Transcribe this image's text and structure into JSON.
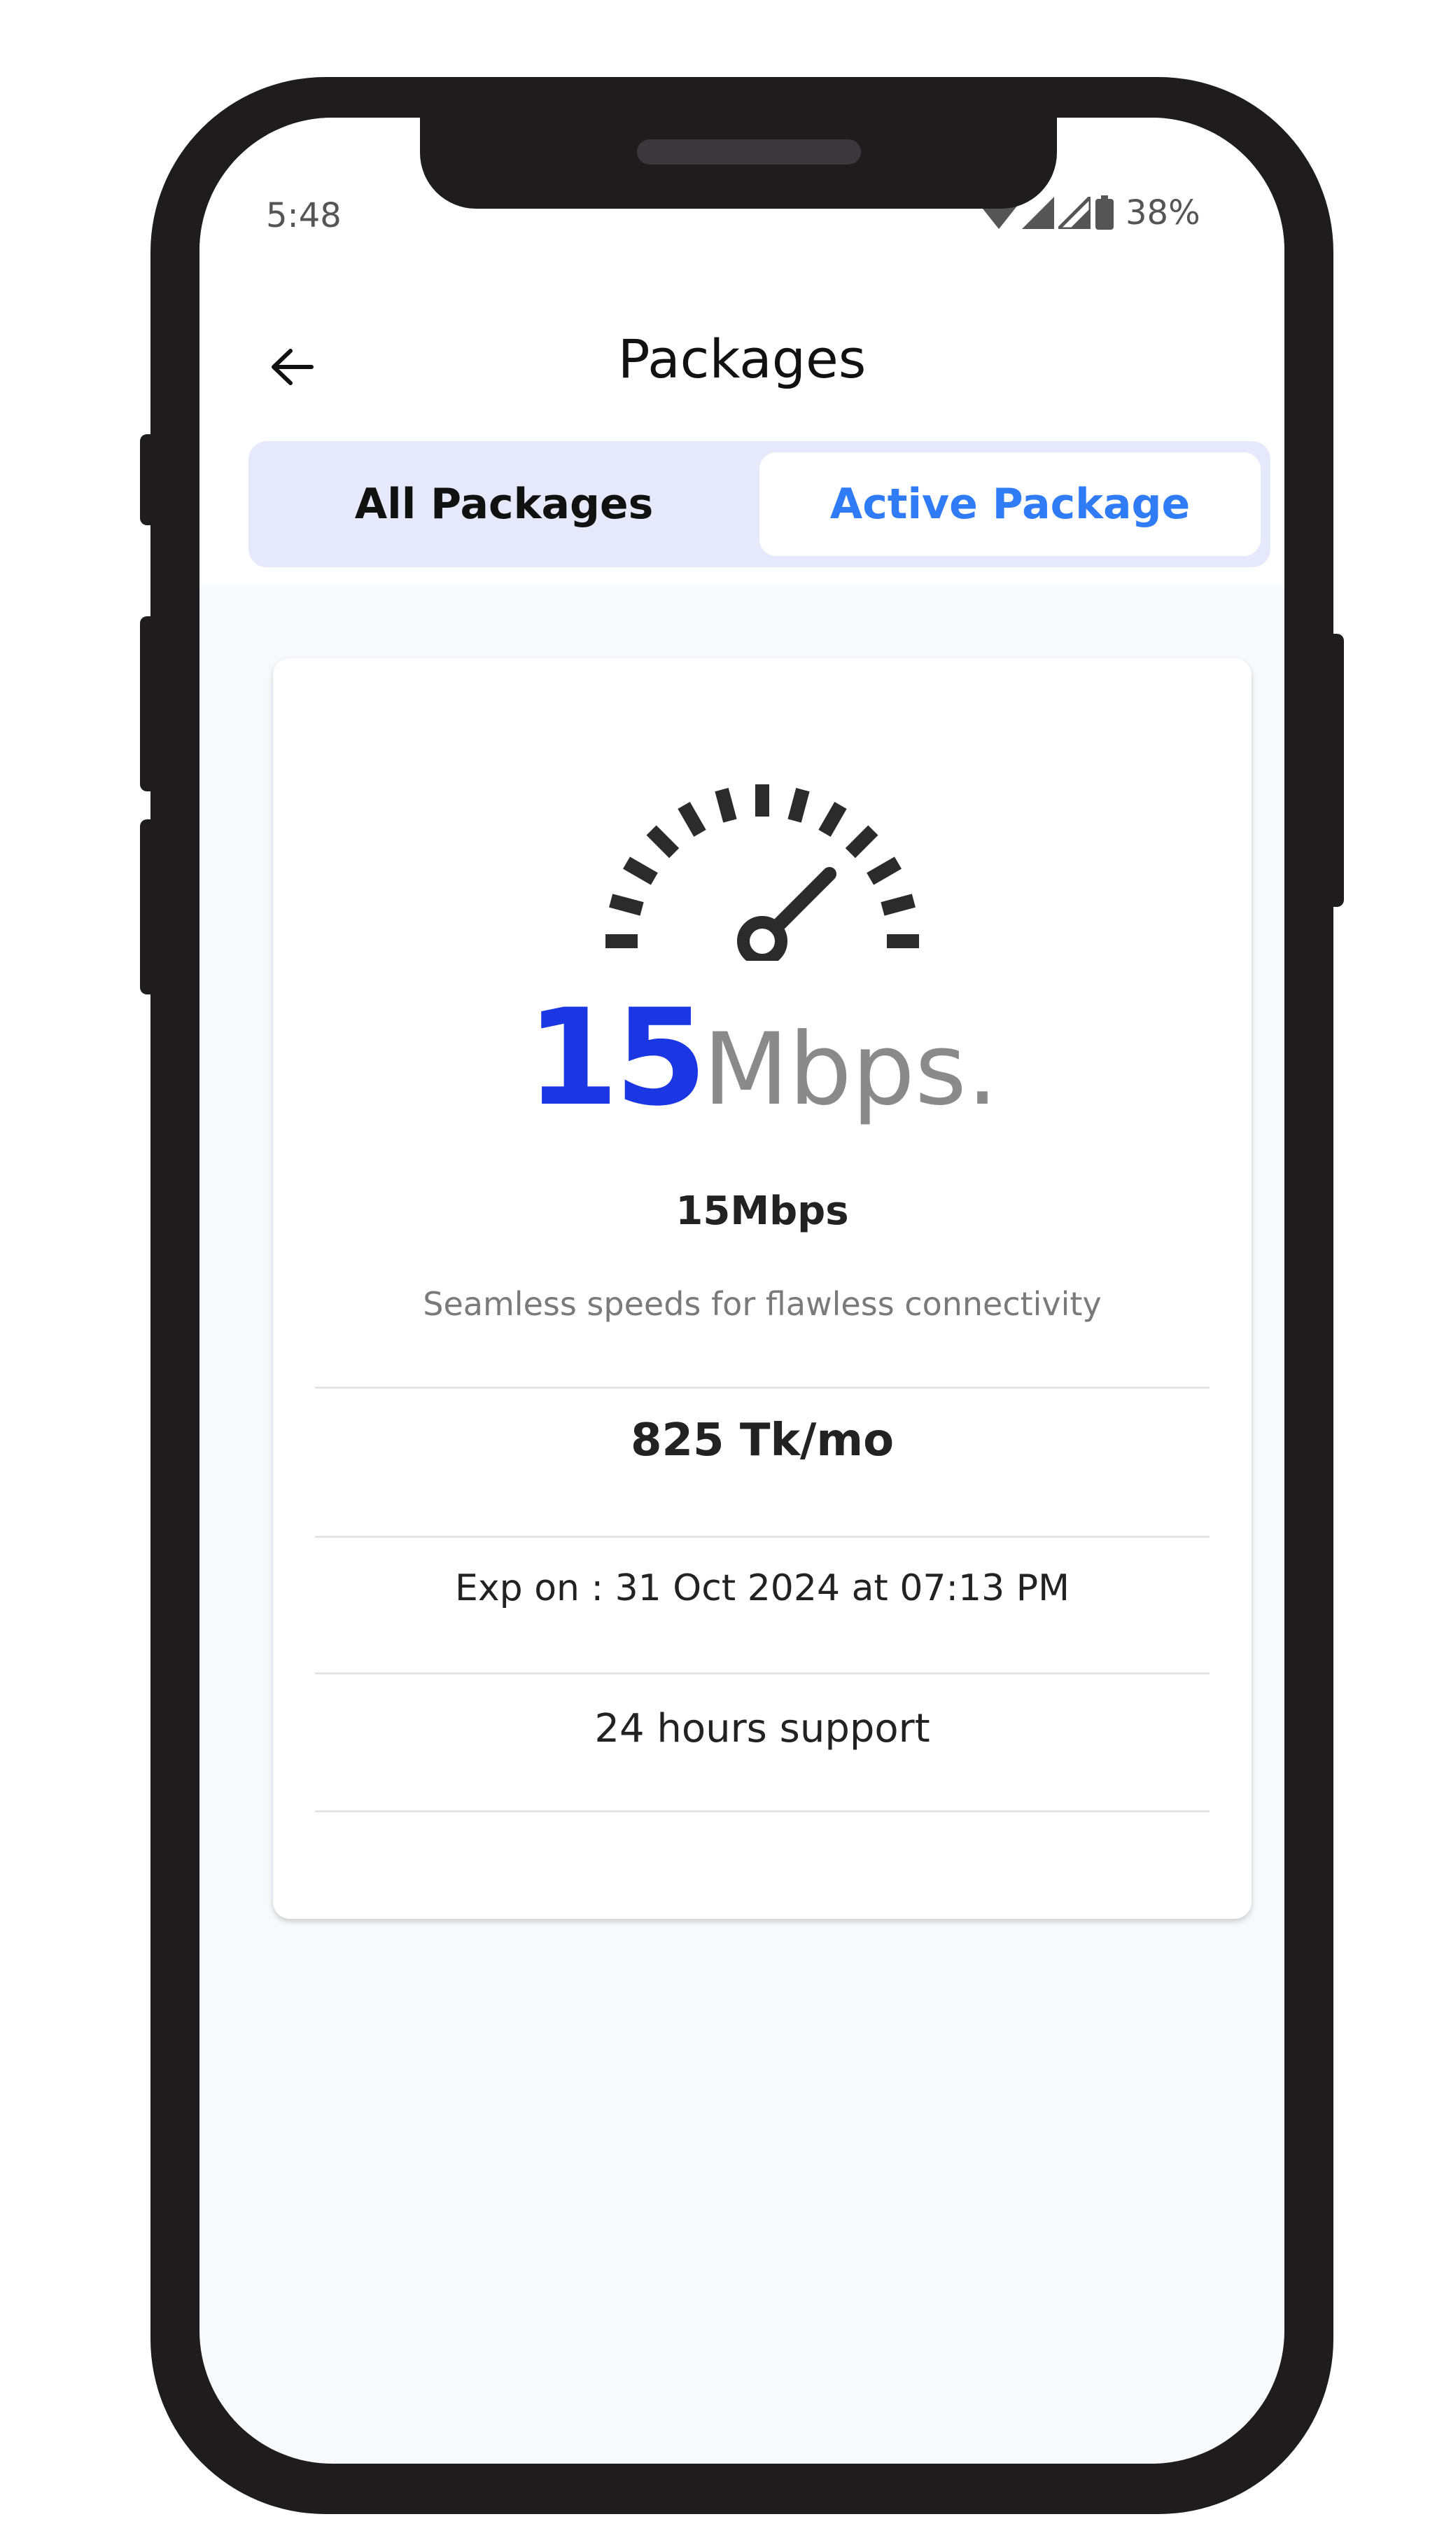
{
  "status_bar": {
    "time": "5:48",
    "battery": "38%",
    "icons": [
      "wifi-icon",
      "signal-icon",
      "signal-icon",
      "battery-icon"
    ]
  },
  "header": {
    "title": "Packages",
    "back_icon": "back-arrow-icon"
  },
  "tabs": [
    {
      "label": "All Packages",
      "selected": false
    },
    {
      "label": "Active Package",
      "selected": true
    }
  ],
  "package": {
    "speed_value": "15",
    "speed_unit": "Mbps.",
    "name": "15Mbps",
    "description": "Seamless speeds for flawless connectivity",
    "price": "825 Tk/mo",
    "expiry": "Exp on : 31 Oct 2024 at 07:13 PM",
    "support": "24 hours support",
    "icon": "speedometer-icon"
  },
  "colors": {
    "accent": "#2f7cf6",
    "speed_blue": "#1a37e3",
    "segment_bg": "#e6e9fb",
    "frame": "#1e1c1d"
  }
}
